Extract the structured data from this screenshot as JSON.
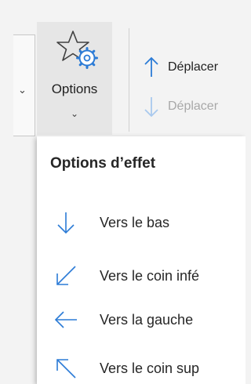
{
  "ribbon": {
    "gallery_more_icon": "chevron-down-icon",
    "options_button": {
      "label": "Options",
      "icon": "star-gear-icon",
      "dropdown_icon": "chevron-down-icon"
    },
    "reorder": {
      "move_up_label": "Déplacer",
      "move_down_label": "Déplacer"
    },
    "colors": {
      "accent": "#c43e1c",
      "arrow_blue": "#2b7bd6",
      "arrow_blue_disabled": "#a9c9ee"
    }
  },
  "dropdown": {
    "title": "Options d’effet",
    "items": [
      {
        "label": "Vers le bas",
        "icon": "arrow-down-icon"
      },
      {
        "label": "Vers le coin infé",
        "icon": "arrow-down-left-icon"
      },
      {
        "label": "Vers la gauche",
        "icon": "arrow-left-icon"
      },
      {
        "label": "Vers le coin sup",
        "icon": "arrow-up-left-icon"
      }
    ]
  }
}
